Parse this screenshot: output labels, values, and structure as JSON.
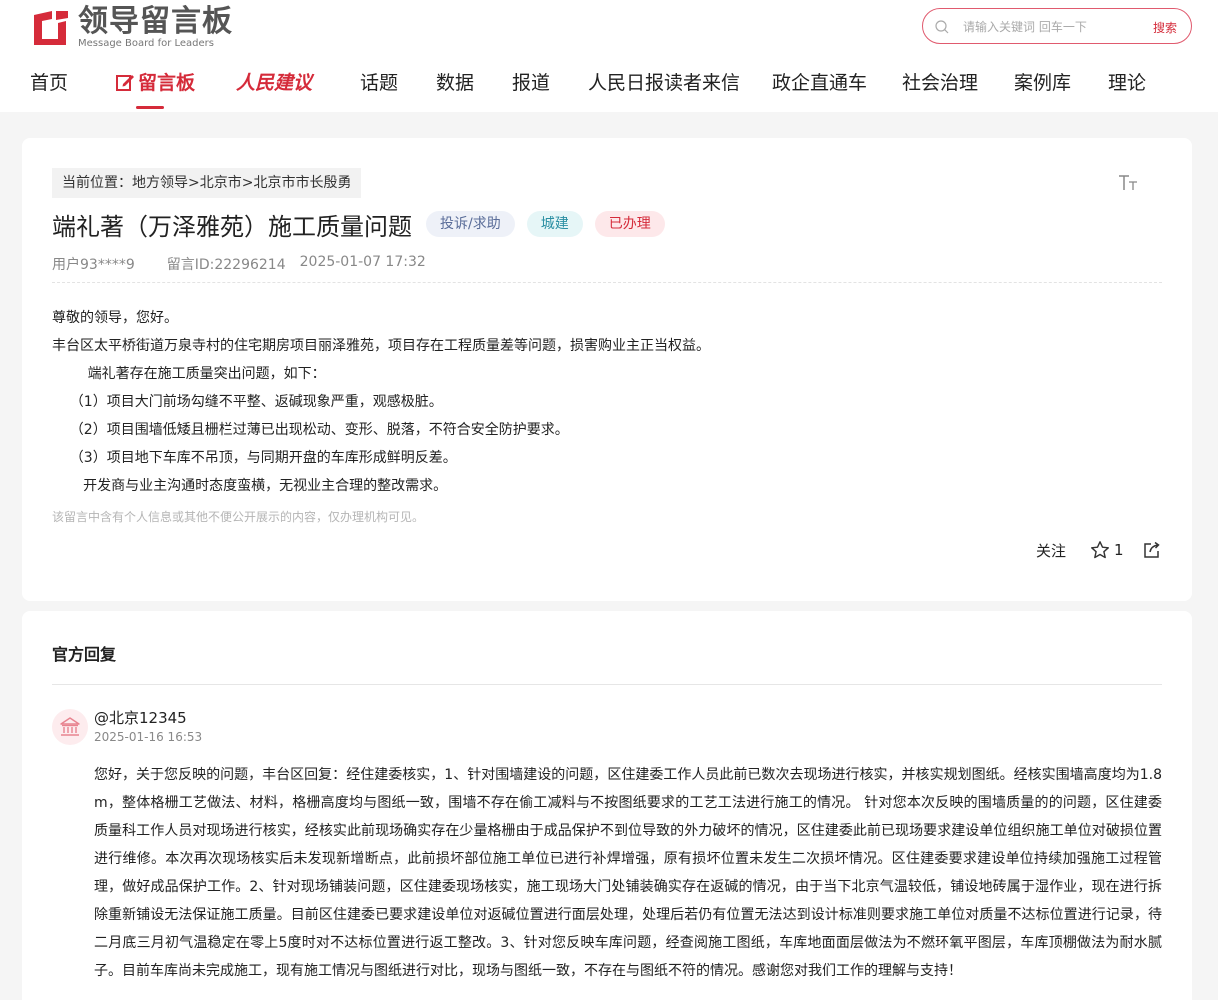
{
  "brand": {
    "name_cn": "领导留言板",
    "name_en": "Message Board for Leaders",
    "color": "#d52b3a"
  },
  "search": {
    "placeholder": "请输入关键词 回车一下",
    "button_label": "搜索"
  },
  "nav": {
    "items": [
      "首页",
      "留言板",
      "人民建议",
      "话题",
      "数据",
      "报道",
      "人民日报读者来信",
      "政企直通车",
      "社会治理",
      "案例库",
      "理论"
    ],
    "active": "留言板"
  },
  "post": {
    "breadcrumb": {
      "prefix": "当前位置：",
      "items": [
        "地方领导",
        "北京市",
        "北京市市长殷勇"
      ],
      "separator": " > "
    },
    "title": "端礼著（万泽雅苑）施工质量问题",
    "tags": {
      "type": "投诉/求助",
      "category": "城建",
      "status": "已办理"
    },
    "user": "用户93****9",
    "message_id": "留言ID:22296214",
    "datetime": "2025-01-07 17:32",
    "content": [
      "尊敬的领导，您好。",
      "丰台区太平桥街道万泉寺村的住宅期房项目丽泽雅苑，项目存在工程质量差等问题，损害购业主正当权益。",
      "        端礼著存在施工质量突出问题，如下：",
      "    （1）项目大门前场勾缝不平整、返碱现象严重，观感极脏。",
      "    （2）项目围墙低矮且栅栏过薄已出现松动、变形、脱落，不符合安全防护要求。",
      "    （3）项目地下车库不吊顶，与同期开盘的车库形成鲜明反差。",
      "       开发商与业主沟通时态度蛮横，无视业主合理的整改需求。"
    ],
    "privacy_note": "该留言中含有个人信息或其他不便公开展示的内容，仅办理机构可见。",
    "actions": {
      "follow_label": "关注",
      "star_count": "1"
    }
  },
  "reply": {
    "heading": "官方回复",
    "replier": "@北京12345",
    "datetime": "2025-01-16 16:53",
    "body": "您好，关于您反映的问题，丰台区回复：经住建委核实，1、针对围墙建设的问题，区住建委工作人员此前已数次去现场进行核实，并核实规划图纸。经核实围墙高度均为1.8m，整体格栅工艺做法、材料，格栅高度均与图纸一致，围墙不存在偷工减料与不按图纸要求的工艺工法进行施工的情况。 针对您本次反映的围墙质量的的问题，区住建委质量科工作人员对现场进行核实，经核实此前现场确实存在少量格栅由于成品保护不到位导致的外力破坏的情况，区住建委此前已现场要求建设单位组织施工单位对破损位置进行维修。本次再次现场核实后未发现新增断点，此前损坏部位施工单位已进行补焊增强，原有损坏位置未发生二次损坏情况。区住建委要求建设单位持续加强施工过程管理，做好成品保护工作。2、针对现场铺装问题，区住建委现场核实，施工现场大门处铺装确实存在返碱的情况，由于当下北京气温较低，铺设地砖属于湿作业，现在进行拆除重新铺设无法保证施工质量。目前区住建委已要求建设单位对返碱位置进行面层处理，处理后若仍有位置无法达到设计标准则要求施工单位对质量不达标位置进行记录，待二月底三月初气温稳定在零上5度时对不达标位置进行返工整改。3、针对您反映车库问题，经查阅施工图纸，车库地面面层做法为不燃环氧平图层，车库顶棚做法为耐水腻子。目前车库尚未完成施工，现有施工情况与图纸进行对比，现场与图纸一致，不存在与图纸不符的情况。感谢您对我们工作的理解与支持！"
  }
}
